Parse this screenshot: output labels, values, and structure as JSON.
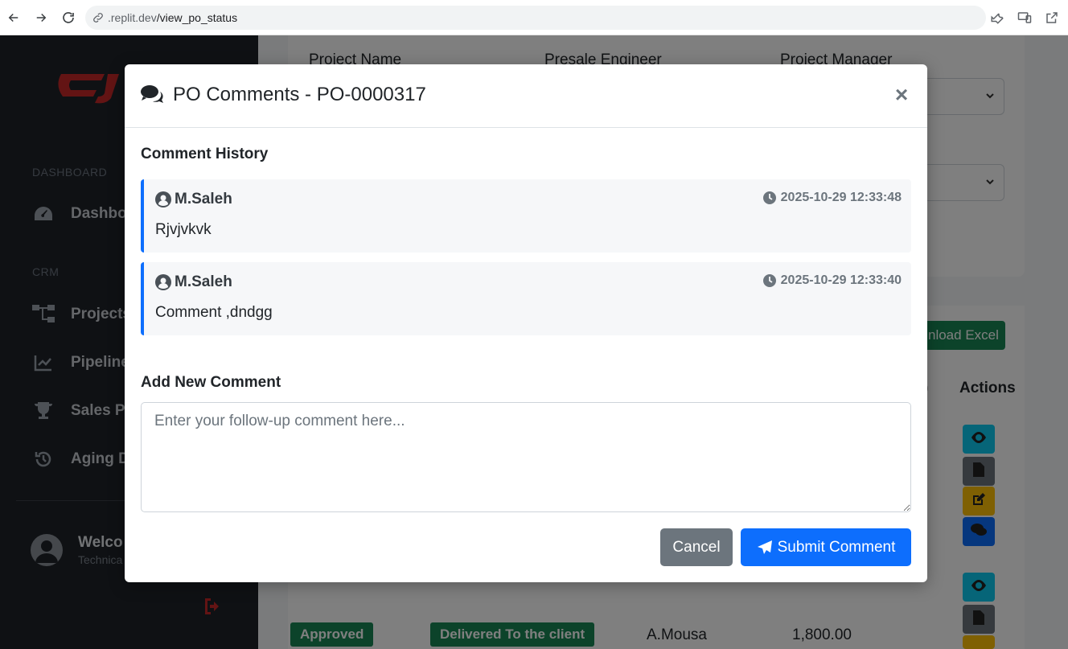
{
  "browser": {
    "url_prefix": ".replit.dev",
    "url_path": "/view_po_status"
  },
  "sidebar": {
    "sections": [
      "DASHBOARD",
      "CRM"
    ],
    "items": [
      {
        "label": "Dashbo",
        "icon": "tachometer-icon"
      },
      {
        "label": "Projects",
        "icon": "sitemap-icon"
      },
      {
        "label": "Pipeline",
        "icon": "chart-line-icon"
      },
      {
        "label": "Sales Pe",
        "icon": "trophy-icon"
      },
      {
        "label": "Aging D",
        "icon": "history-icon"
      }
    ],
    "welcome": "Welco",
    "welcome_sub": "Technica"
  },
  "background": {
    "col_labels": [
      "Project Name",
      "Presale Engineer",
      "Project Manager"
    ],
    "excel_button": "nload Excel",
    "actions_header": "Actions",
    "paren_fragment": ")",
    "row": {
      "status_badge": "Approved",
      "delivery_badge": "Delivered To the client",
      "person": "A.Mousa",
      "amount": "1,800.00"
    }
  },
  "modal": {
    "title": "PO Comments - PO-0000317",
    "close_symbol": "×",
    "history_title": "Comment History",
    "comments": [
      {
        "user": "M.Saleh",
        "time": "2025-10-29 12:33:48",
        "text": "Rjvjvkvk"
      },
      {
        "user": "M.Saleh",
        "time": "2025-10-29 12:33:40",
        "text": "Comment ,dndgg"
      }
    ],
    "add_title": "Add New Comment",
    "input_placeholder": "Enter your follow-up comment here...",
    "cancel_label": "Cancel",
    "submit_label": "Submit Comment"
  },
  "colors": {
    "primary": "#0d6efd",
    "secondary": "#6c757d",
    "success": "#198754",
    "sidebar_bg": "#1f2329",
    "brand_red": "#c62828"
  }
}
